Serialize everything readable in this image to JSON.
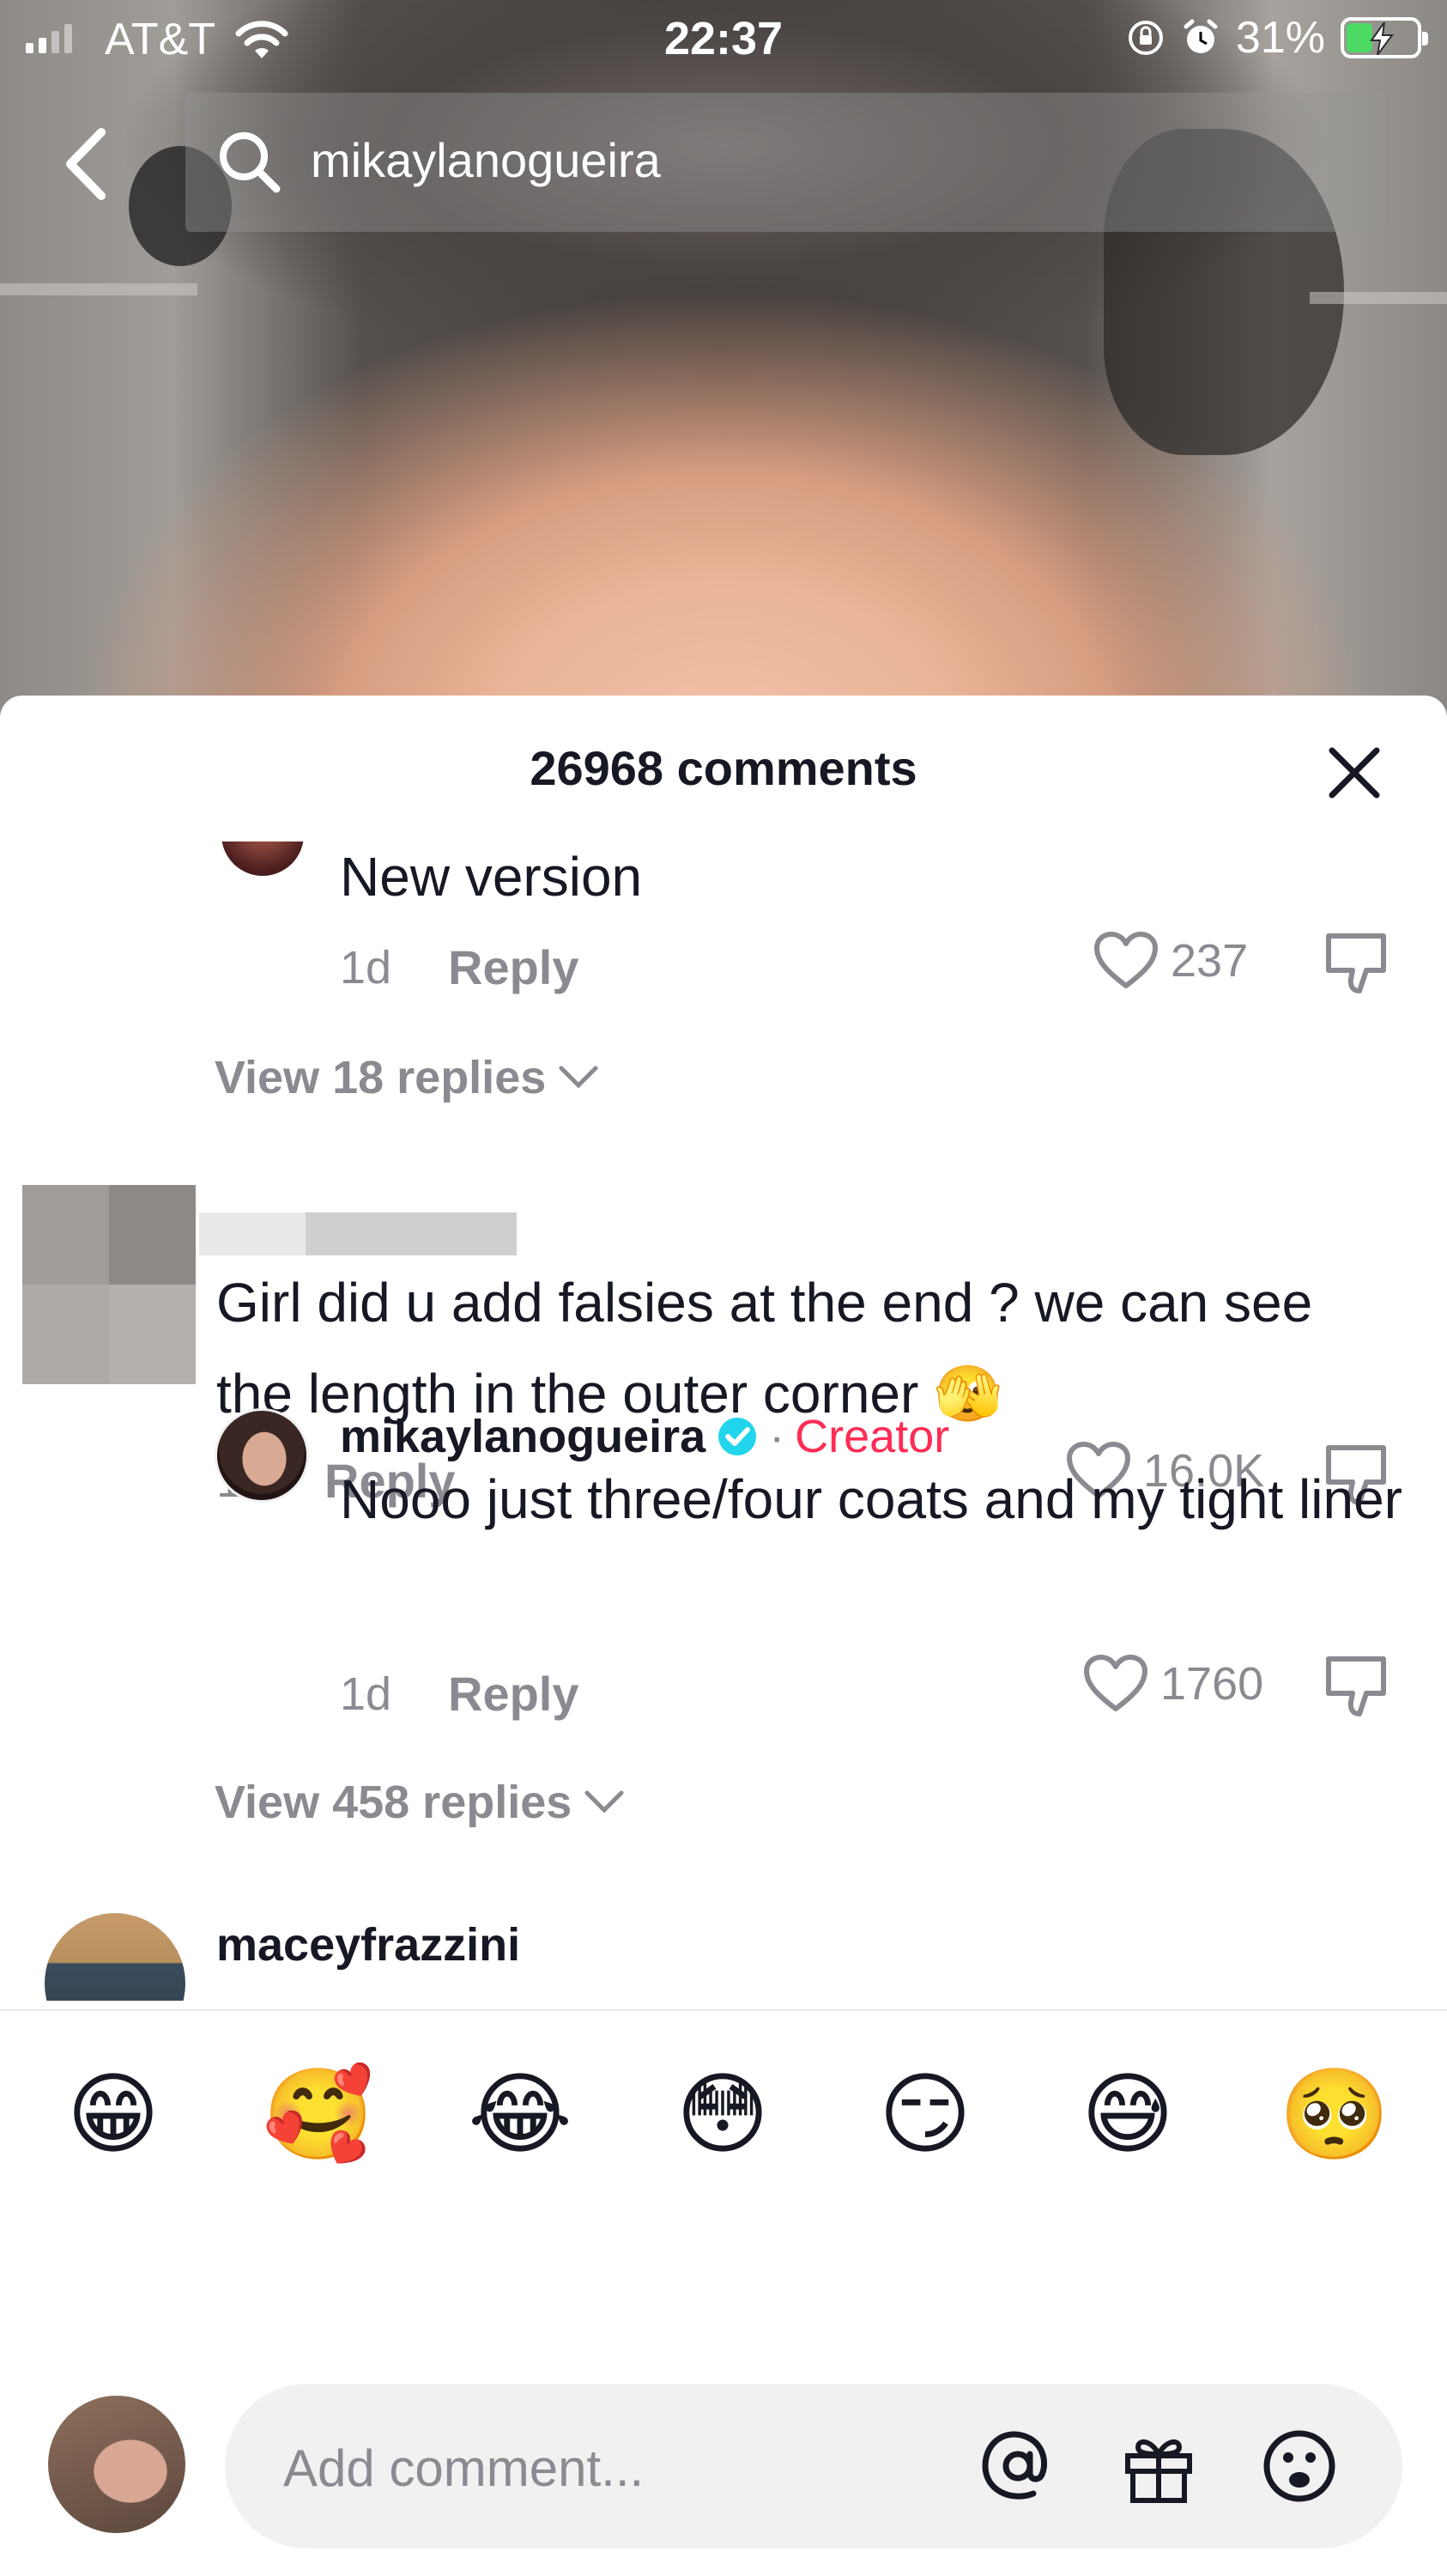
{
  "status_bar": {
    "carrier": "AT&T",
    "time": "22:37",
    "battery_percent": "31%",
    "battery_level": 0.31,
    "icons": [
      "signal-icon",
      "wifi-icon",
      "orientation-lock-icon",
      "alarm-icon",
      "battery-charging-icon"
    ]
  },
  "search": {
    "query": "mikaylanogueira",
    "icons": [
      "back-arrow-icon",
      "search-icon"
    ]
  },
  "sheet": {
    "title": "26968 comments",
    "close_icon": "close-icon"
  },
  "comments": [
    {
      "text": "New version",
      "time": "1d",
      "reply_label": "Reply",
      "likes": "237",
      "view_replies": "View 18 replies"
    },
    {
      "text": "Girl did u add falsies at the end ? we can see the length in the outer corner 🫣",
      "time": "1d",
      "reply_label": "Reply",
      "likes": "16.0K",
      "reply": {
        "username": "mikaylanogueira",
        "dot": "·",
        "badge": "Creator",
        "text": "Nooo just three/four coats and my tight liner",
        "time": "1d",
        "reply_label": "Reply",
        "likes": "1760"
      },
      "view_replies": "View 458 replies"
    },
    {
      "username": "maceyfrazzini"
    }
  ],
  "emoji_bar": [
    "😁",
    "🥰",
    "😂",
    "😳",
    "😏",
    "😅",
    "🥺"
  ],
  "composer": {
    "placeholder": "Add comment...",
    "icons": [
      "mention-icon",
      "gift-icon",
      "emoji-icon"
    ]
  },
  "colors": {
    "creator_badge": "#fe2c55",
    "verified": "#20d5ec",
    "muted_text": "#8a8b91",
    "primary_text": "#161823"
  }
}
